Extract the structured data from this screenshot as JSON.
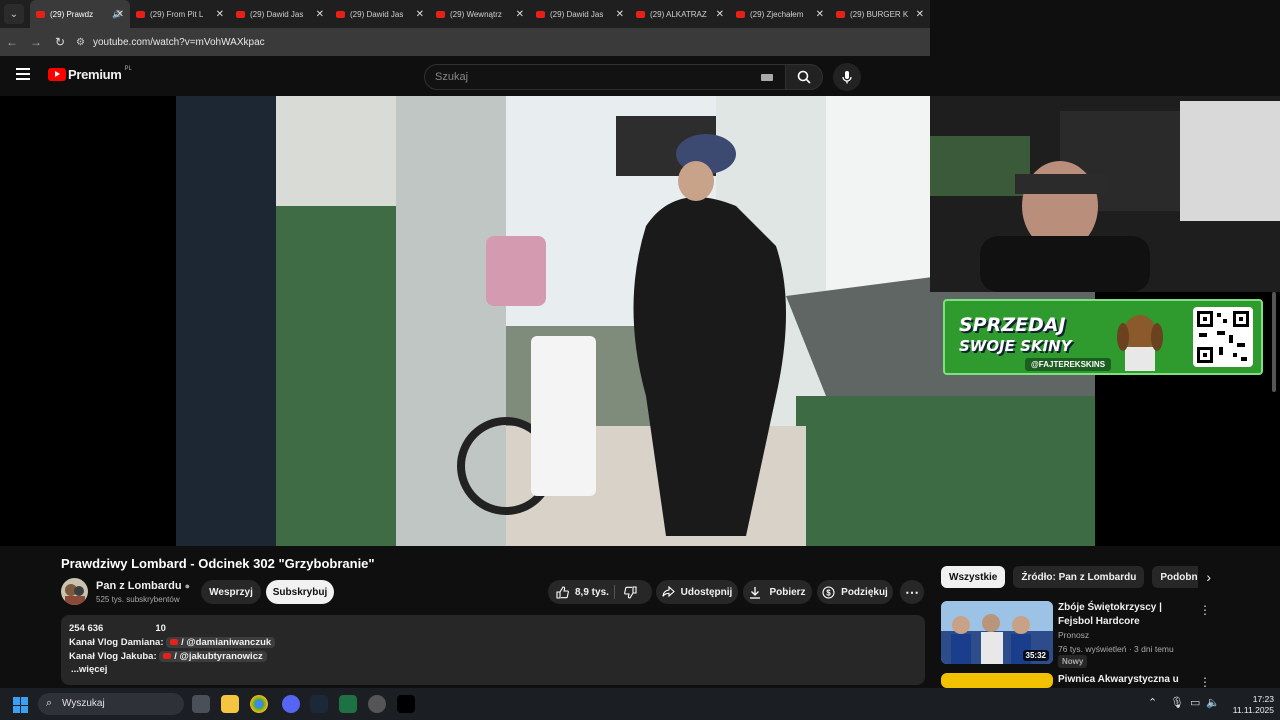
{
  "browser": {
    "tabs": [
      {
        "label": "(29) Prawdz",
        "active": true,
        "audio": true
      },
      {
        "label": "(29) From Pit L",
        "active": false
      },
      {
        "label": "(29) Dawid Jas",
        "active": false
      },
      {
        "label": "(29) Dawid Jas",
        "active": false
      },
      {
        "label": "(29) Wewnątrz",
        "active": false
      },
      {
        "label": "(29) Dawid Jas",
        "active": false
      },
      {
        "label": "(29) ALKATRAZ",
        "active": false
      },
      {
        "label": "(29) Zjechałem",
        "active": false
      },
      {
        "label": "(29) BURGER K",
        "active": false
      }
    ],
    "url": "youtube.com/watch?v=mVohWAXkpac"
  },
  "header": {
    "logo_text": "Premium",
    "logo_region": "PL",
    "search_placeholder": "Szukaj"
  },
  "overlay": {
    "promo_line1": "SPRZEDAJ",
    "promo_line2": "SWOJE SKINY",
    "promo_handle": "@FAJTEREKSKINS"
  },
  "video": {
    "title": "Prawdziwy Lombard - Odcinek 302 \"Grzybobranie\"",
    "channel_name": "Pan z Lombardu",
    "channel_subs": "525 tys. subskrybentów",
    "support_label": "Wesprzyj",
    "subscribe_label": "Subskrybuj",
    "likes": "8,9 tys.",
    "share_label": "Udostępnij",
    "download_label": "Pobierz",
    "thanks_label": "Podziękuj",
    "more_label": "⋯"
  },
  "description": {
    "views": "254 636",
    "episode": "10",
    "line1_prefix": "Kanał Vlog Damiana:",
    "line1_handle": "/ @damianiwanczuk",
    "line2_prefix": "Kanał Vlog Jakuba:",
    "line2_handle": "/ @jakubtyranowicz",
    "more": "...więcej"
  },
  "sidebar": {
    "chips": [
      "Wszystkie",
      "Źródło: Pan z Lombardu",
      "Podobne"
    ],
    "recommendations": [
      {
        "title": "Zbóje Świętokrzyscy | Fejsbol Hardcore",
        "channel": "Pronosz",
        "meta": "76 tys. wyświetleń · 3 dni temu",
        "badge": "Nowy",
        "duration": "35:32"
      },
      {
        "title": "Piwnica Akwarystyczna u",
        "channel": "",
        "meta": "",
        "badge": "",
        "duration": ""
      }
    ]
  },
  "taskbar": {
    "search_placeholder": "Wyszukaj",
    "time": "17:23",
    "date": "11.11.2025"
  },
  "colors": {
    "accent_red": "#ff0000",
    "promo_green": "#2f9b2f"
  }
}
